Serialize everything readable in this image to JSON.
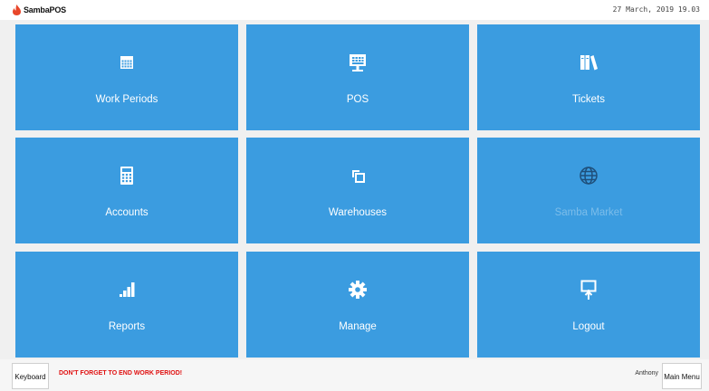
{
  "header": {
    "brand": "SambaPOS",
    "datetime": "27 March, 2019 19.03"
  },
  "tiles": [
    {
      "label": "Work Periods",
      "icon": "calendar-icon"
    },
    {
      "label": "POS",
      "icon": "monitor-icon"
    },
    {
      "label": "Tickets",
      "icon": "books-icon"
    },
    {
      "label": "Accounts",
      "icon": "calculator-icon"
    },
    {
      "label": "Warehouses",
      "icon": "boxes-icon"
    },
    {
      "label": "Samba Market",
      "icon": "globe-icon",
      "disabled": true
    },
    {
      "label": "Reports",
      "icon": "signal-bars-icon"
    },
    {
      "label": "Manage",
      "icon": "gear-icon"
    },
    {
      "label": "Logout",
      "icon": "logout-screen-icon"
    }
  ],
  "footer": {
    "keyboard_label": "Keyboard",
    "warning": "DON'T FORGET TO END WORK PERIOD!",
    "user": "Anthony",
    "main_menu_label": "Main Menu"
  },
  "colors": {
    "tile": "#3b9ce0",
    "tile_disabled_text": "#7cbdea",
    "warning": "#e01010",
    "brand_flame": "#e8462a"
  }
}
